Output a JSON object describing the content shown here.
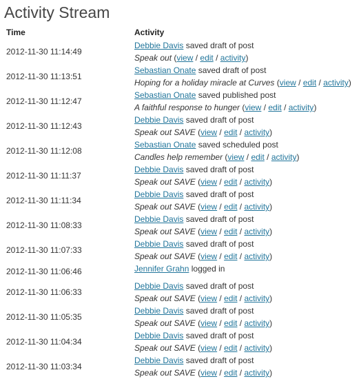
{
  "page": {
    "title": "Activity Stream"
  },
  "table": {
    "headers": {
      "time": "Time",
      "activity": "Activity"
    },
    "links": {
      "view": "view",
      "edit": "edit",
      "activity": "activity"
    },
    "rows": [
      {
        "time": "2012-11-30 11:14:49",
        "user": "Debbie Davis",
        "action": " saved draft of post",
        "post": "Speak out"
      },
      {
        "time": "2012-11-30 11:13:51",
        "user": "Sebastian Onate",
        "action": " saved draft of post",
        "post": "Hoping for a holiday miracle at Curves"
      },
      {
        "time": "2012-11-30 11:12:47",
        "user": "Sebastian Onate",
        "action": " saved published post",
        "post": "A faithful response to hunger"
      },
      {
        "time": "2012-11-30 11:12:43",
        "user": "Debbie Davis",
        "action": " saved draft of post",
        "post": "Speak out SAVE"
      },
      {
        "time": "2012-11-30 11:12:08",
        "user": "Sebastian Onate",
        "action": " saved scheduled post",
        "post": "Candles help remember"
      },
      {
        "time": "2012-11-30 11:11:37",
        "user": "Debbie Davis",
        "action": " saved draft of post",
        "post": "Speak out SAVE"
      },
      {
        "time": "2012-11-30 11:11:34",
        "user": "Debbie Davis",
        "action": " saved draft of post",
        "post": "Speak out SAVE"
      },
      {
        "time": "2012-11-30 11:08:33",
        "user": "Debbie Davis",
        "action": " saved draft of post",
        "post": "Speak out SAVE"
      },
      {
        "time": "2012-11-30 11:07:33",
        "user": "Debbie Davis",
        "action": " saved draft of post",
        "post": "Speak out SAVE"
      },
      {
        "time": "2012-11-30 11:06:46",
        "user": "Jennifer Grahn",
        "action": " logged in",
        "post": null
      },
      {
        "time": "2012-11-30 11:06:33",
        "user": "Debbie Davis",
        "action": " saved draft of post",
        "post": "Speak out SAVE"
      },
      {
        "time": "2012-11-30 11:05:35",
        "user": "Debbie Davis",
        "action": " saved draft of post",
        "post": "Speak out SAVE"
      },
      {
        "time": "2012-11-30 11:04:34",
        "user": "Debbie Davis",
        "action": " saved draft of post",
        "post": "Speak out SAVE"
      },
      {
        "time": "2012-11-30 11:03:34",
        "user": "Debbie Davis",
        "action": " saved draft of post",
        "post": "Speak out SAVE"
      }
    ]
  }
}
